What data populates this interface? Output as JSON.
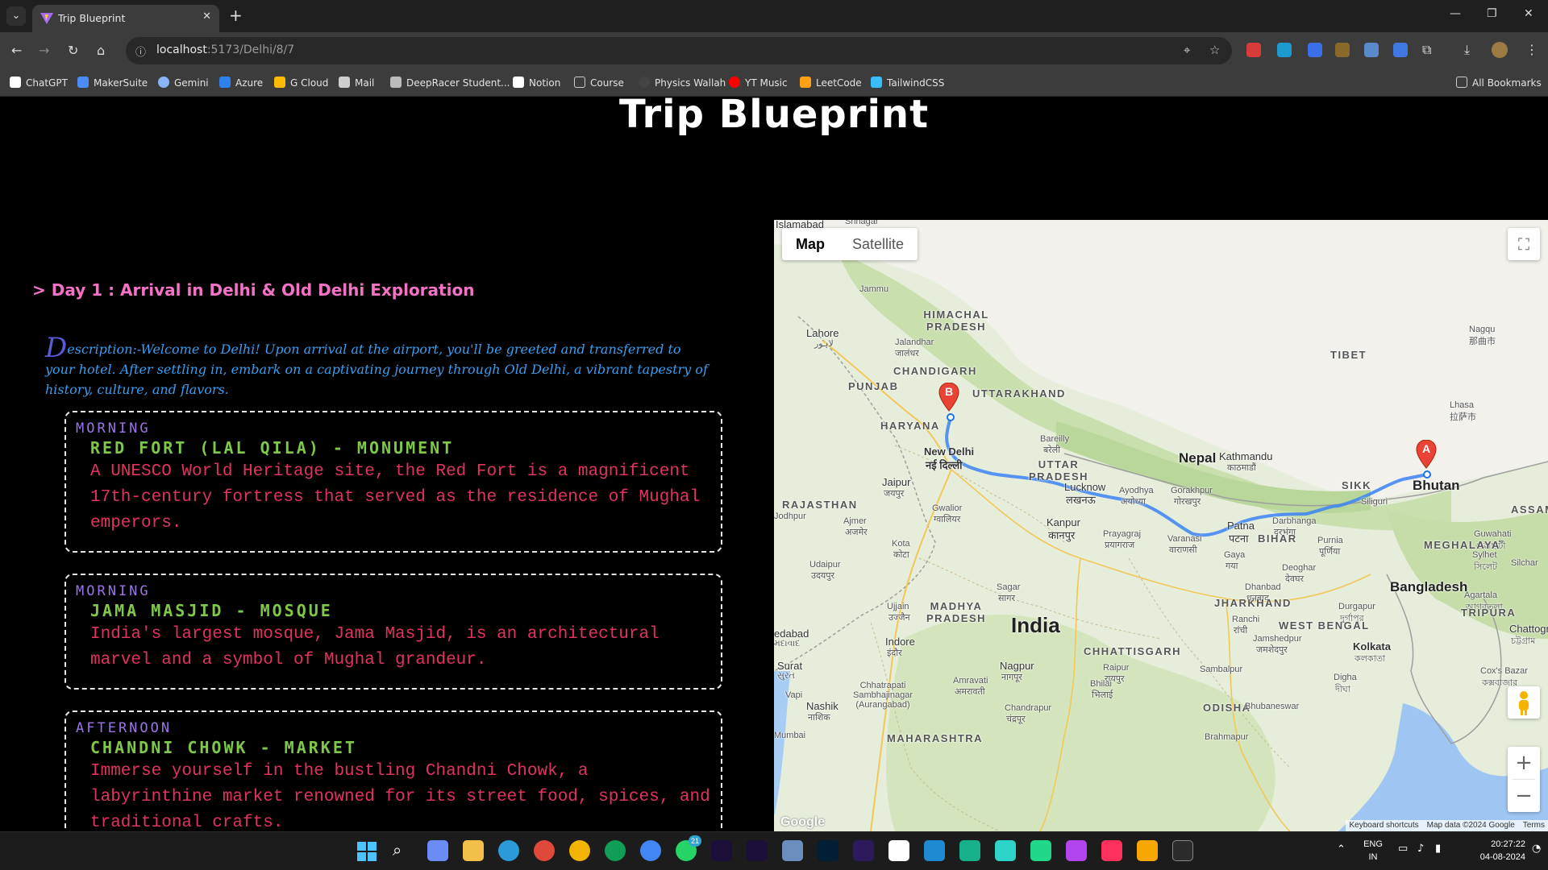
{
  "browser": {
    "tab_title": "Trip Blueprint",
    "url_host": "localhost",
    "url_path": ":5173/Delhi/8/7",
    "bookmarks": [
      {
        "label": "ChatGPT",
        "color": "#ffffff"
      },
      {
        "label": "MakerSuite",
        "color": "#4b8bf5"
      },
      {
        "label": "Gemini",
        "color": "#8ab4f8"
      },
      {
        "label": "Azure",
        "color": "#2f80ed"
      },
      {
        "label": "G Cloud",
        "color": "#fbbc04"
      },
      {
        "label": "Mail",
        "color": "#cfcfcf"
      },
      {
        "label": "DeepRacer Student...",
        "color": "#bbbbbb"
      },
      {
        "label": "Notion",
        "color": "#ffffff"
      },
      {
        "label": "Course",
        "color": "#cfcfcf"
      },
      {
        "label": "Physics Wallah",
        "color": "#444444"
      },
      {
        "label": "YT Music",
        "color": "#ff0000"
      },
      {
        "label": "LeetCode",
        "color": "#ffa116"
      },
      {
        "label": "TailwindCSS",
        "color": "#38bdf8"
      }
    ],
    "all_bookmarks": "All Bookmarks"
  },
  "page": {
    "title": "Trip Blueprint",
    "day_title": "> Day 1 : Arrival in Delhi & Old Delhi Exploration",
    "description_initial": "D",
    "description_rest": "escription:-Welcome to Delhi! Upon arrival at the airport, you'll be greeted and transferred to your hotel. After settling in, embark on a captivating journey through Old Delhi, a vibrant tapestry of history, culture, and flavors.",
    "activities": [
      {
        "slot": "MORNING",
        "place": "RED FORT (LAL QILA) - MONUMENT",
        "description": "A UNESCO World Heritage site, the Red Fort is a magnificent 17th-century fortress that served as the residence of Mughal emperors."
      },
      {
        "slot": "MORNING",
        "place": "JAMA MASJID - MOSQUE",
        "description": "India's largest mosque, Jama Masjid, is an architectural marvel and a symbol of Mughal grandeur."
      },
      {
        "slot": "AFTERNOON",
        "place": "CHANDNI CHOWK - MARKET",
        "description": "Immerse yourself in the bustling Chandni Chowk, a labyrinthine market renowned for its street food, spices, and traditional crafts."
      }
    ]
  },
  "map": {
    "type_map": "Map",
    "type_satellite": "Satellite",
    "attribution": [
      "Keyboard shortcuts",
      "Map data ©2024 Google",
      "Terms"
    ],
    "google": "Google",
    "marker_a": "A",
    "marker_b": "B",
    "labels": {
      "islamabad": "Islamabad",
      "srinagar": "Srinagar",
      "jammu": "Jammu",
      "himachal": "HIMACHAL PRADESH",
      "lahore": "Lahore",
      "lahore_sub": "لاہور",
      "jalandhar": "Jalandhar",
      "jalandhar_sub": "जालंधर",
      "chandigarh": "CHANDIGARH",
      "punjab": "PUNJAB",
      "uttarakhand": "UTTARAKHAND",
      "haryana": "HARYANA",
      "tibet": "TIBET",
      "naqu": "Nagqu",
      "naqu_sub": "那曲市",
      "lhasa": "Lhasa",
      "lhasa_sub": "拉萨市",
      "newdelhi": "New Delhi",
      "newdelhi_sub": "नई दिल्ली",
      "bareilly": "Bareilly",
      "bareilly_sub": "बरेली",
      "uttarpradesh": "UTTAR PRADESH",
      "nepal": "Nepal",
      "kathmandu": "Kathmandu",
      "kathmandu_sub": "काठमाडौं",
      "sikkim": "SIKK",
      "bhutan": "Bhutan",
      "jaipur": "Jaipur",
      "jaipur_sub": "जयपुर",
      "lucknow": "Lucknow",
      "lucknow_sub": "लखनऊ",
      "ayodhya": "Ayodhya",
      "ayodhya_sub": "अयोध्या",
      "gorakhpur": "Gorakhpur",
      "gorakhpur_sub": "गोरखपुर",
      "siliguri": "Siliguri",
      "rajasthan": "RAJASTHAN",
      "gwalior": "Gwalior",
      "gwalior_sub": "ग्वालियर",
      "kanpur": "Kanpur",
      "kanpur_sub": "कानपुर",
      "patna": "Patna",
      "patna_sub": "पटना",
      "darbhanga": "Darbhanga",
      "darbhanga_sub": "दरभंगा",
      "assam": "ASSAM",
      "guwahati": "Guwahati",
      "guwahati_sub": "গুৱাহাটী",
      "jodhpur": "Jodhpur",
      "ajmer": "Ajmer",
      "ajmer_sub": "अजमेर",
      "prayagraj": "Prayagraj",
      "prayagraj_sub": "प्रयागराज",
      "varanasi": "Varanasi",
      "varanasi_sub": "वाराणसी",
      "bihar": "BIHAR",
      "purnia": "Purnia",
      "purnia_sub": "पूर्णिया",
      "meghalaya": "MEGHALAYA",
      "sylhet": "Sylhet",
      "sylhet_sub": "সিলেট",
      "silchar": "Silchar",
      "kota": "Kota",
      "kota_sub": "कोटा",
      "gaya": "Gaya",
      "gaya_sub": "गया",
      "udaipur": "Udaipur",
      "udaipur_sub": "उदयपुर",
      "deoghar": "Deoghar",
      "deoghar_sub": "देवघर",
      "sagar": "Sagar",
      "sagar_sub": "सागर",
      "dhanbad": "Dhanbad",
      "dhanbad_sub": "धनबाद",
      "bangladesh": "Bangladesh",
      "agartala": "Agartala",
      "agartala_sub": "আগরতলা",
      "jharkhand": "JHARKHAND",
      "durgapur": "Durgapur",
      "durgapur_sub": "দুর্গাপুর",
      "tripura": "TRIPURA",
      "ujjain": "Ujjain",
      "ujjain_sub": "उज्जैन",
      "madhyapradesh": "MADHYA PRADESH",
      "india": "India",
      "ranchi": "Ranchi",
      "ranchi_sub": "रांची",
      "westbengal": "WEST BENGAL",
      "chattogram": "Chattogra",
      "chattogram_sub": "চট্টগ্রাম",
      "ahmedabad": "edabad",
      "ahmedabad_sub": "મદાવાદ",
      "indore": "Indore",
      "indore_sub": "इंदौर",
      "jamshedpur": "Jamshedpur",
      "jamshedpur_sub": "जमशेदपुर",
      "chhattisgarh": "CHHATTISGARH",
      "kolkata": "Kolkata",
      "kolkata_sub": "কলকাতা",
      "surat": "Surat",
      "surat_sub": "સુરત",
      "nagpur": "Nagpur",
      "nagpur_sub": "नागपूर",
      "raipur": "Raipur",
      "raipur_sub": "रायपुर",
      "sambalpur": "Sambalpur",
      "coxsbazar": "Cox's Bazar",
      "coxsbazar_sub": "কক্সবাজার",
      "amravati": "Amravati",
      "amravati_sub": "अमरावती",
      "digha": "Digha",
      "digha_sub": "দীঘা",
      "bhilai": "Bhilai",
      "bhilai_sub": "भिलाई",
      "chhatrapati": "Chhatrapati Sambhajinagar (Aurangabad)",
      "nashik": "Nashik",
      "nashik_sub": "नाशिक",
      "chandrapur": "Chandrapur",
      "chandrapur_sub": "चंद्रपूर",
      "odisha": "ODISHA",
      "bhubaneswar": "Bhubaneswar",
      "vapi": "Vapi",
      "mumbai": "Mumbai",
      "maharashtra": "MAHARASHTRA",
      "brahmapur": "Brahmapur"
    }
  },
  "taskbar": {
    "lang": "ENG",
    "region": "IN",
    "time": "20:27:22",
    "date": "04-08-2024",
    "whatsapp_badge": "21"
  }
}
